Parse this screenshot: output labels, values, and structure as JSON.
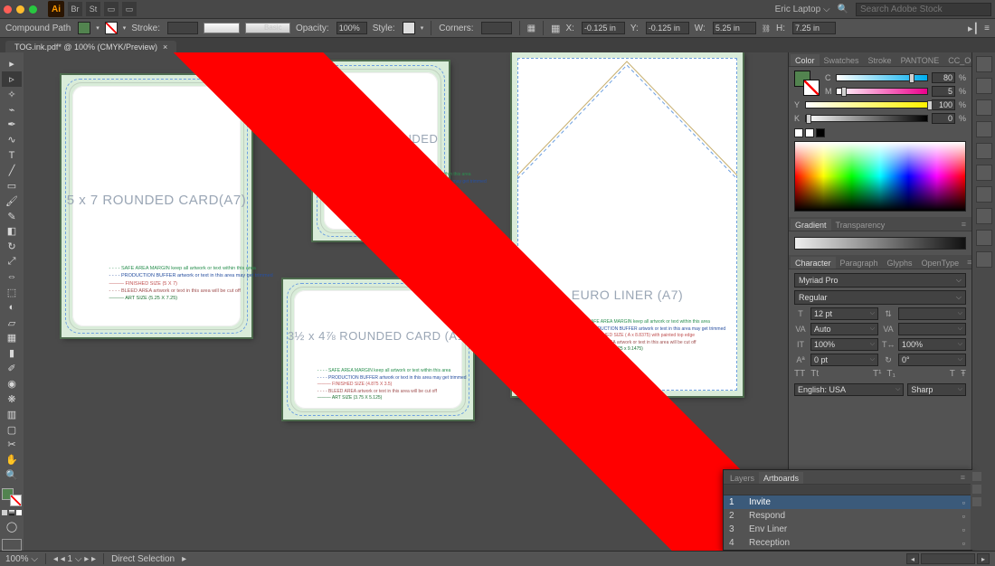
{
  "app": {
    "user": "Eric Laptop",
    "search_ph": "Search Adobe Stock"
  },
  "ctrl": {
    "mode": "Compound Path",
    "fill_lbl": "Fill:",
    "stroke_lbl": "Stroke:",
    "stroke_style": "Basic",
    "opacity_lbl": "Opacity:",
    "opacity": "100%",
    "style_lbl": "Style:",
    "corners_lbl": "Corners:",
    "x_lbl": "X:",
    "x": "-0.125 in",
    "y_lbl": "Y:",
    "y": "-0.125 in",
    "w_lbl": "W:",
    "w": "5.25 in",
    "h_lbl": "H:",
    "h": "7.25 in"
  },
  "doc": {
    "tab": "TOG.ink.pdf* @ 100% (CMYK/Preview)"
  },
  "cards": {
    "a7": "5 x 7 ROUNDED CARD(A7)",
    "a1": "3½ x 4⅞  ROUNDED CARD (A1)",
    "euro": "EURO LINER (A7)",
    "leg_safe": "- - - - SAFE AREA MARGIN keep all artwork or text within this area",
    "leg_prod": "- - - - PRODUCTION BUFFER artwork or text in this area may get trimmed",
    "leg_fin": "——— FINISHED SIZE (5 X 7)",
    "leg_fin_a1": "——— FINISHED SIZE (4.875 X 3.5)",
    "leg_fin_euro": "——— FINISHED SIZE ( A x 8.8375) with painted top edge",
    "leg_bleed": "- - - - BLEED AREA  artwork or text in this area will be cut off",
    "leg_art": "——— ART SIZE (5.25 X 7.25)",
    "leg_art_a1": "——— ART SIZE (3.75 X 5.125)",
    "leg_art_euro": "——— ART SIZE (6.25 x 9.1475)"
  },
  "color": {
    "tabs": [
      "Color",
      "Swatches",
      "Stroke",
      "PANTONE",
      "CC_Online"
    ],
    "c": "80",
    "m": "5",
    "y": "100",
    "k": "0"
  },
  "grad": {
    "tabs": [
      "Gradient",
      "Transparency"
    ]
  },
  "char": {
    "tabs": [
      "Character",
      "Paragraph",
      "Glyphs",
      "OpenType"
    ],
    "font": "Myriad Pro",
    "weight": "Regular",
    "size": "12 pt",
    "leading": "",
    "kern": "Auto",
    "track": "",
    "vscale": "100%",
    "hscale": "100%",
    "baseline": "0 pt",
    "rotate": "0°",
    "lang": "English: USA",
    "aa": "Sharp"
  },
  "artboards": {
    "tabs": [
      "Layers",
      "Artboards"
    ],
    "items": [
      {
        "n": "1",
        "name": "Invite"
      },
      {
        "n": "2",
        "name": "Respond"
      },
      {
        "n": "3",
        "name": "Env Liner"
      },
      {
        "n": "4",
        "name": "Reception"
      }
    ]
  },
  "status": {
    "zoom": "100%",
    "ab": "1",
    "tool": "Direct Selection"
  }
}
